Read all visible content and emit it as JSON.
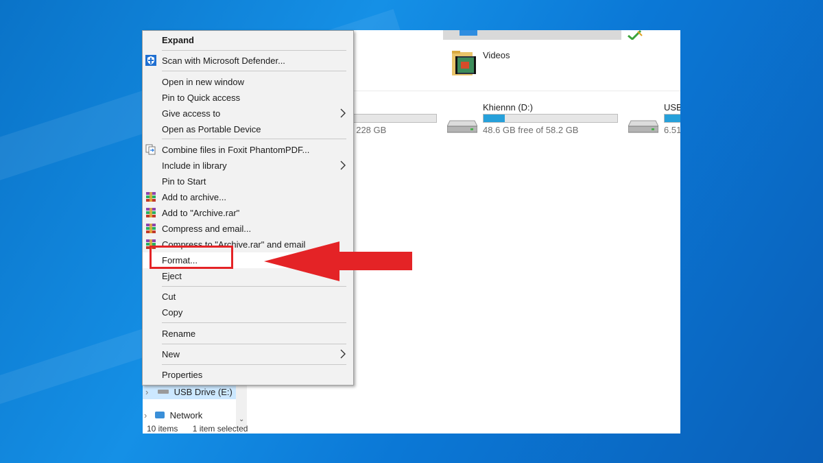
{
  "explorer": {
    "folders": [
      {
        "label": "Videos",
        "icon": "video-folder-icon"
      }
    ],
    "drives": [
      {
        "label": "",
        "free_text": "f 228 GB",
        "used_fraction": 0.05
      },
      {
        "label": "Khiennn (D:)",
        "free_text": "48.6 GB free of 58.2 GB",
        "used_fraction": 0.16
      },
      {
        "label": "USB",
        "free_text": "6.51",
        "used_fraction": 0.9
      }
    ],
    "navpane": {
      "usb_label": "USB Drive (E:)",
      "network_label": "Network"
    },
    "status": {
      "items": "10 items",
      "selected": "1 item selected"
    }
  },
  "context_menu": {
    "items": [
      {
        "label": "Expand",
        "bold": true
      },
      {
        "label": "Scan with Microsoft Defender...",
        "icon": "defender-shield-icon"
      },
      {
        "label": "Open in new window"
      },
      {
        "label": "Pin to Quick access"
      },
      {
        "label": "Give access to",
        "submenu": true
      },
      {
        "label": "Open as Portable Device"
      },
      {
        "label": "Combine files in Foxit PhantomPDF...",
        "icon": "foxit-combine-icon"
      },
      {
        "label": "Include in library",
        "submenu": true
      },
      {
        "label": "Pin to Start"
      },
      {
        "label": "Add to archive...",
        "icon": "winrar-icon"
      },
      {
        "label": "Add to \"Archive.rar\"",
        "icon": "winrar-icon"
      },
      {
        "label": "Compress and email...",
        "icon": "winrar-icon"
      },
      {
        "label": "Compress to \"Archive.rar\" and email",
        "icon": "winrar-icon"
      },
      {
        "label": "Format..."
      },
      {
        "label": "Eject"
      },
      {
        "label": "Cut"
      },
      {
        "label": "Copy"
      },
      {
        "label": "Rename"
      },
      {
        "label": "New",
        "submenu": true
      },
      {
        "label": "Properties"
      }
    ]
  },
  "colors": {
    "accent": "#26a0da",
    "highlight_red": "#e42326"
  }
}
